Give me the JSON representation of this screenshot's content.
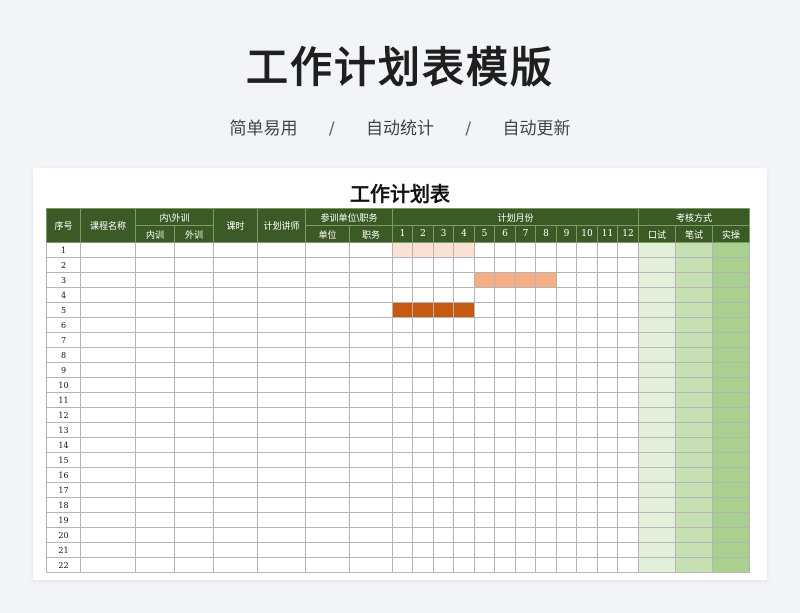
{
  "header": {
    "title": "工作计划表模版",
    "features": [
      "简单易用",
      "自动统计",
      "自动更新"
    ],
    "separator": "/"
  },
  "sheet": {
    "title": "工作计划表",
    "columns": {
      "seq": "序号",
      "course": "课程名称",
      "inout": "内\\外训",
      "in": "内训",
      "out": "外训",
      "hours": "课时",
      "lecturer": "计划讲师",
      "unit_role": "参训单位\\职务",
      "unit": "单位",
      "role": "职务",
      "months_group": "计划月份",
      "months": [
        "1",
        "2",
        "3",
        "4",
        "5",
        "6",
        "7",
        "8",
        "9",
        "10",
        "11",
        "12"
      ],
      "exam": "考核方式",
      "oral": "口试",
      "written": "笔试",
      "practical": "实操"
    },
    "rows": [
      "1",
      "2",
      "3",
      "4",
      "5",
      "6",
      "7",
      "8",
      "9",
      "10",
      "11",
      "12",
      "13",
      "14",
      "15",
      "16",
      "17",
      "18",
      "19",
      "20",
      "21",
      "22"
    ],
    "bars": [
      {
        "row": 1,
        "months": [
          1,
          2,
          3,
          4
        ],
        "color": "#fbe2d5"
      },
      {
        "row": 3,
        "months": [
          5,
          6,
          7,
          8
        ],
        "color": "#f4b084"
      },
      {
        "row": 5,
        "months": [
          1,
          2,
          3,
          4
        ],
        "color": "#c55a11"
      }
    ],
    "colors": {
      "header_bg": "#3b5a25",
      "exam_oral": "#e2efd9",
      "exam_written": "#c6e0b4",
      "exam_practical": "#a9d08e"
    }
  }
}
